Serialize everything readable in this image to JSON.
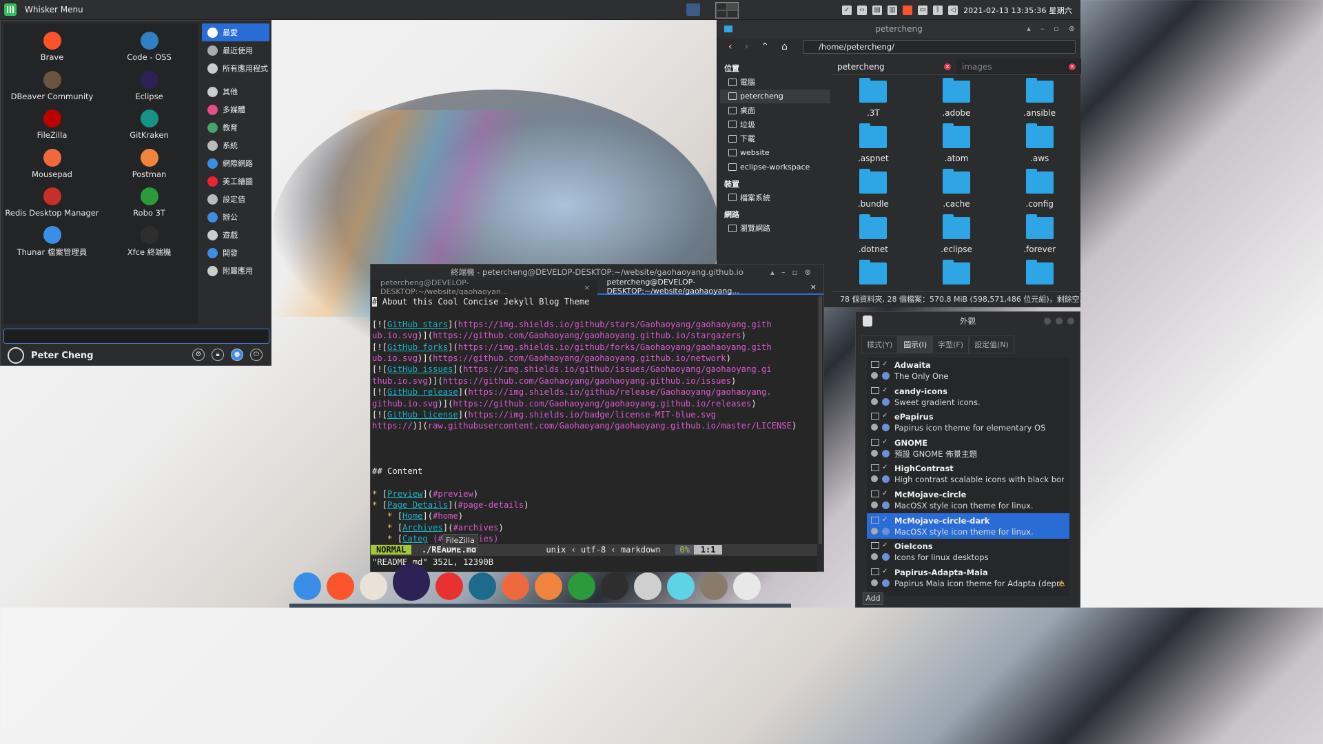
{
  "top_panel": {
    "menu_title": "Whisker Menu",
    "clock": "2021-02-13 13:35:36 星期六"
  },
  "whisker": {
    "apps": [
      {
        "label": "Brave",
        "icon": "brave-icon",
        "color": "#fb542b"
      },
      {
        "label": "Code - OSS",
        "icon": "code-oss-icon",
        "color": "#2f80c4"
      },
      {
        "label": "DBeaver Community",
        "icon": "dbeaver-icon",
        "color": "#6b5540"
      },
      {
        "label": "Eclipse",
        "icon": "eclipse-icon",
        "color": "#2c2255"
      },
      {
        "label": "FileZilla",
        "icon": "filezilla-icon",
        "color": "#bf0000"
      },
      {
        "label": "GitKraken",
        "icon": "gitkraken-icon",
        "color": "#179287"
      },
      {
        "label": "Mousepad",
        "icon": "mousepad-icon",
        "color": "#ee6a3e"
      },
      {
        "label": "Postman",
        "icon": "postman-icon",
        "color": "#f0843c"
      },
      {
        "label": "Redis Desktop Manager",
        "icon": "redis-icon",
        "color": "#c6302b"
      },
      {
        "label": "Robo 3T",
        "icon": "robo3t-icon",
        "color": "#2b9a3a"
      },
      {
        "label": "Thunar 檔案管理員",
        "icon": "thunar-icon",
        "color": "#3a8ee6"
      },
      {
        "label": "Xfce 終端機",
        "icon": "terminal-icon",
        "color": "#2e2e2e"
      }
    ],
    "categories": [
      {
        "label": "最愛",
        "icon": "star-icon",
        "active": true
      },
      {
        "label": "最近使用",
        "icon": "history-icon"
      },
      {
        "label": "所有應用程式",
        "icon": "gear-icon"
      },
      {
        "label": "其他",
        "icon": "gear-icon"
      },
      {
        "label": "多媒體",
        "icon": "music-icon"
      },
      {
        "label": "教育",
        "icon": "education-icon"
      },
      {
        "label": "系統",
        "icon": "system-icon"
      },
      {
        "label": "網際網路",
        "icon": "internet-icon"
      },
      {
        "label": "美工繪圖",
        "icon": "graphics-icon"
      },
      {
        "label": "設定值",
        "icon": "settings-icon"
      },
      {
        "label": "辦公",
        "icon": "office-icon"
      },
      {
        "label": "遊戲",
        "icon": "games-icon"
      },
      {
        "label": "開發",
        "icon": "development-icon"
      },
      {
        "label": "附屬應用",
        "icon": "accessories-icon"
      }
    ],
    "search_value": "",
    "user_name": "Peter Cheng"
  },
  "thunar": {
    "title": "petercheng",
    "path": "/home/petercheng/",
    "sections": {
      "places_header": "位置",
      "places": [
        "電腦",
        "petercheng",
        "桌面",
        "垃圾",
        "下載",
        "website",
        "eclipse-workspace"
      ],
      "devices_header": "裝置",
      "devices": [
        "檔案系統"
      ],
      "network_header": "網路",
      "network": [
        "瀏覽網路"
      ]
    },
    "tabs": [
      "petercheng",
      "images"
    ],
    "folders": [
      ".3T",
      ".adobe",
      ".ansible",
      ".aspnet",
      ".atom",
      ".aws",
      ".bundle",
      ".cache",
      ".config",
      ".dotnet",
      ".eclipse",
      ".forever",
      "",
      "",
      ""
    ],
    "status": "78 個資料夾, 28 個檔案：570.8 MiB (598,571,486 位元組)，剩餘空..."
  },
  "terminal": {
    "title": "終端機 - petercheng@DEVELOP-DESKTOP:~/website/gaohaoyang.github.io",
    "tabs": [
      "petercheng@DEVELOP-DESKTOP:~/website/gaohaoyan...",
      "petercheng@DEVELOP-DESKTOP:~/website/gaohaoyang..."
    ],
    "heading": "About this Cool Concise Jekyll Blog Theme",
    "badges": [
      {
        "a": "GitHub stars",
        "b": "https://img.shields.io/github/stars/Gaohaoyang/gaohaoyang.gith",
        "c": "ub.io.svg",
        "d": "https://github.com/Gaohaoyang/gaohaoyang.github.io/stargazers"
      },
      {
        "a": "GitHub forks",
        "b": "https://img.shields.io/github/forks/Gaohaoyang/gaohaoyang.gith",
        "c": "ub.io.svg",
        "d": "https://github.com/Gaohaoyang/gaohaoyang.github.io/network"
      },
      {
        "a": "GitHub issues",
        "b": "https://img.shields.io/github/issues/Gaohaoyang/gaohaoyang.gi",
        "c": "thub.io.svg",
        "d": "https://github.com/Gaohaoyang/gaohaoyang.github.io/issues"
      },
      {
        "a": "GitHub release",
        "b": "https://img.shields.io/github/release/Gaohaoyang/gaohaoyang.",
        "c": "github.io.svg",
        "d": "https://github.com/Gaohaoyang/gaohaoyang.github.io/releases"
      },
      {
        "a": "GitHub license",
        "b": "https://img.shields.io/badge/license-MIT-blue.svg",
        "c": "https://",
        "d": "raw.githubusercontent.com/Gaohaoyang/gaohaoyang.github.io/master/LICENSE"
      }
    ],
    "content_heading": "Content",
    "toc": [
      {
        "text": "Preview",
        "anchor": "#preview"
      },
      {
        "text": "Page Details",
        "anchor": "#page-details"
      },
      {
        "text": "Home",
        "anchor": "#home"
      },
      {
        "text": "Archives",
        "anchor": "#archives"
      },
      {
        "text": "Categ",
        "anchor": "(#categories)"
      }
    ],
    "tooltip": "FileZilla",
    "statusline": {
      "mode": "NORMAL",
      "file": "./README.md",
      "fmt": "unix",
      "enc": "utf-8",
      "ft": "markdown",
      "pct": "0%",
      "pos": "1:1"
    },
    "message": "\"README.md\" 352L, 12390B"
  },
  "appearance": {
    "title": "外觀",
    "tabs": [
      "樣式(Y)",
      "圖示(I)",
      "字型(F)",
      "設定值(N)"
    ],
    "themes": [
      {
        "name": "Adwaita",
        "desc": "The Only One"
      },
      {
        "name": "candy-icons",
        "desc": "Sweet gradient icons."
      },
      {
        "name": "ePapirus",
        "desc": "Papirus icon theme for elementary OS"
      },
      {
        "name": "GNOME",
        "desc": "預設 GNOME 佈景主題"
      },
      {
        "name": "HighContrast",
        "desc": "High contrast scalable icons with black borders"
      },
      {
        "name": "McMojave-circle",
        "desc": "MacOSX style icon theme for linux."
      },
      {
        "name": "McMojave-circle-dark",
        "desc": "MacOSX style icon theme for linux.",
        "selected": true
      },
      {
        "name": "OieIcons",
        "desc": "Icons for linux desktops"
      },
      {
        "name": "Papirus-Adapta-Maia",
        "desc": "Papirus Maia icon theme for Adapta (depreca..."
      }
    ],
    "add_button": "Add"
  },
  "dock": {
    "items": [
      {
        "icon": "finder-icon",
        "color": "#3a8ee6"
      },
      {
        "icon": "brave-icon",
        "color": "#fb542b"
      },
      {
        "icon": "dbeaver-icon",
        "color": "#e8e2d8"
      },
      {
        "icon": "eclipse-icon",
        "color": "#2c2255"
      },
      {
        "icon": "filezilla-icon",
        "color": "#e83232"
      },
      {
        "icon": "gitkraken-icon",
        "color": "#1d6a8a"
      },
      {
        "icon": "mousepad-icon",
        "color": "#ee6a3e"
      },
      {
        "icon": "postman-icon",
        "color": "#f0843c"
      },
      {
        "icon": "robo3t-icon",
        "color": "#2b9a3a"
      },
      {
        "icon": "terminal-icon",
        "color": "#2e2e2e"
      },
      {
        "icon": "trash-icon",
        "color": "#cfcfcf"
      },
      {
        "icon": "atom-icon",
        "color": "#5fd3e6"
      },
      {
        "icon": "gimp-icon",
        "color": "#8a7a6a"
      },
      {
        "icon": "tie-icon",
        "color": "#e8e8e8"
      }
    ]
  }
}
